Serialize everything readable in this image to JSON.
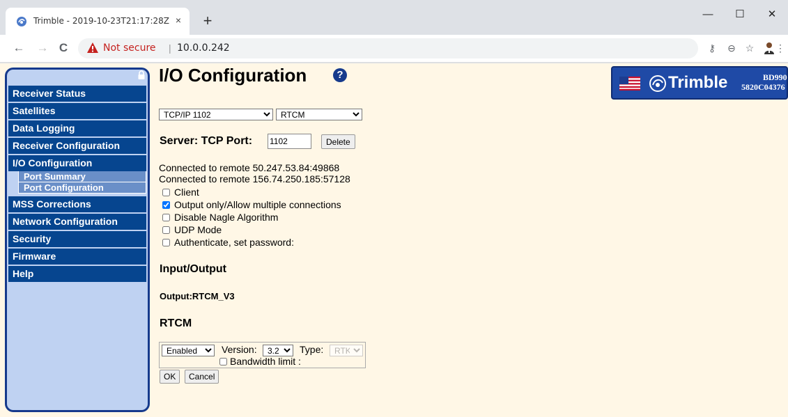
{
  "browser": {
    "tab_title": "Trimble - 2019-10-23T21:17:28Z",
    "tab_close": "×",
    "new_tab": "+",
    "not_secure": "Not secure",
    "separator": "|",
    "url": "10.0.0.242",
    "window_controls": {
      "minimize": "—",
      "maximize": "☐",
      "close": "✕"
    },
    "nav": {
      "back": "←",
      "forward": "→",
      "reload": "C"
    },
    "toolbar_icons": {
      "key": "⚷",
      "zoom": "⊖",
      "star": "☆",
      "menu": "⋮"
    }
  },
  "sidebar": {
    "items": [
      {
        "label": "Receiver Status"
      },
      {
        "label": "Satellites"
      },
      {
        "label": "Data Logging"
      },
      {
        "label": "Receiver Configuration"
      },
      {
        "label": "I/O Configuration"
      }
    ],
    "submenu": [
      {
        "label": "Port Summary"
      },
      {
        "label": "Port Configuration"
      }
    ],
    "items_after": [
      {
        "label": "MSS Corrections"
      },
      {
        "label": "Network Configuration"
      },
      {
        "label": "Security"
      },
      {
        "label": "Firmware"
      },
      {
        "label": "Help"
      }
    ]
  },
  "page": {
    "title": "I/O Configuration",
    "help": "?"
  },
  "brand": {
    "name": "Trimble",
    "model": "BD990",
    "serial": "5820C04376"
  },
  "port": {
    "port_select": "TCP/IP 1102",
    "protocol_select": "RTCM",
    "server_label": "Server: TCP Port:",
    "port_value": "1102",
    "delete_label": "Delete"
  },
  "connections": [
    "Connected to remote 50.247.53.84:49868",
    "Connected to remote 156.74.250.185:57128"
  ],
  "options": [
    {
      "label": "Client",
      "checked": false
    },
    {
      "label": "Output only/Allow multiple connections",
      "checked": true
    },
    {
      "label": "Disable Nagle Algorithm",
      "checked": false
    },
    {
      "label": "UDP Mode",
      "checked": false
    },
    {
      "label": "Authenticate, set password:",
      "checked": false
    }
  ],
  "io": {
    "section_title": "Input/Output",
    "output": "Output:RTCM_V3"
  },
  "rtcm": {
    "section_title": "RTCM",
    "enabled": "Enabled",
    "version_label": "Version:",
    "version": "3.2",
    "type_label": "Type:",
    "type": "RTK",
    "bandwidth_label": "Bandwidth limit :",
    "ok_label": "OK",
    "cancel_label": "Cancel"
  },
  "colors": {
    "page_bg": "#fff7e6",
    "menu_item": "#06458f",
    "submenu_item": "#6a8fc8",
    "sidebar_bg": "#bfd2f2",
    "brand_banner": "#1f4aa6",
    "not_secure": "#c5221f"
  }
}
